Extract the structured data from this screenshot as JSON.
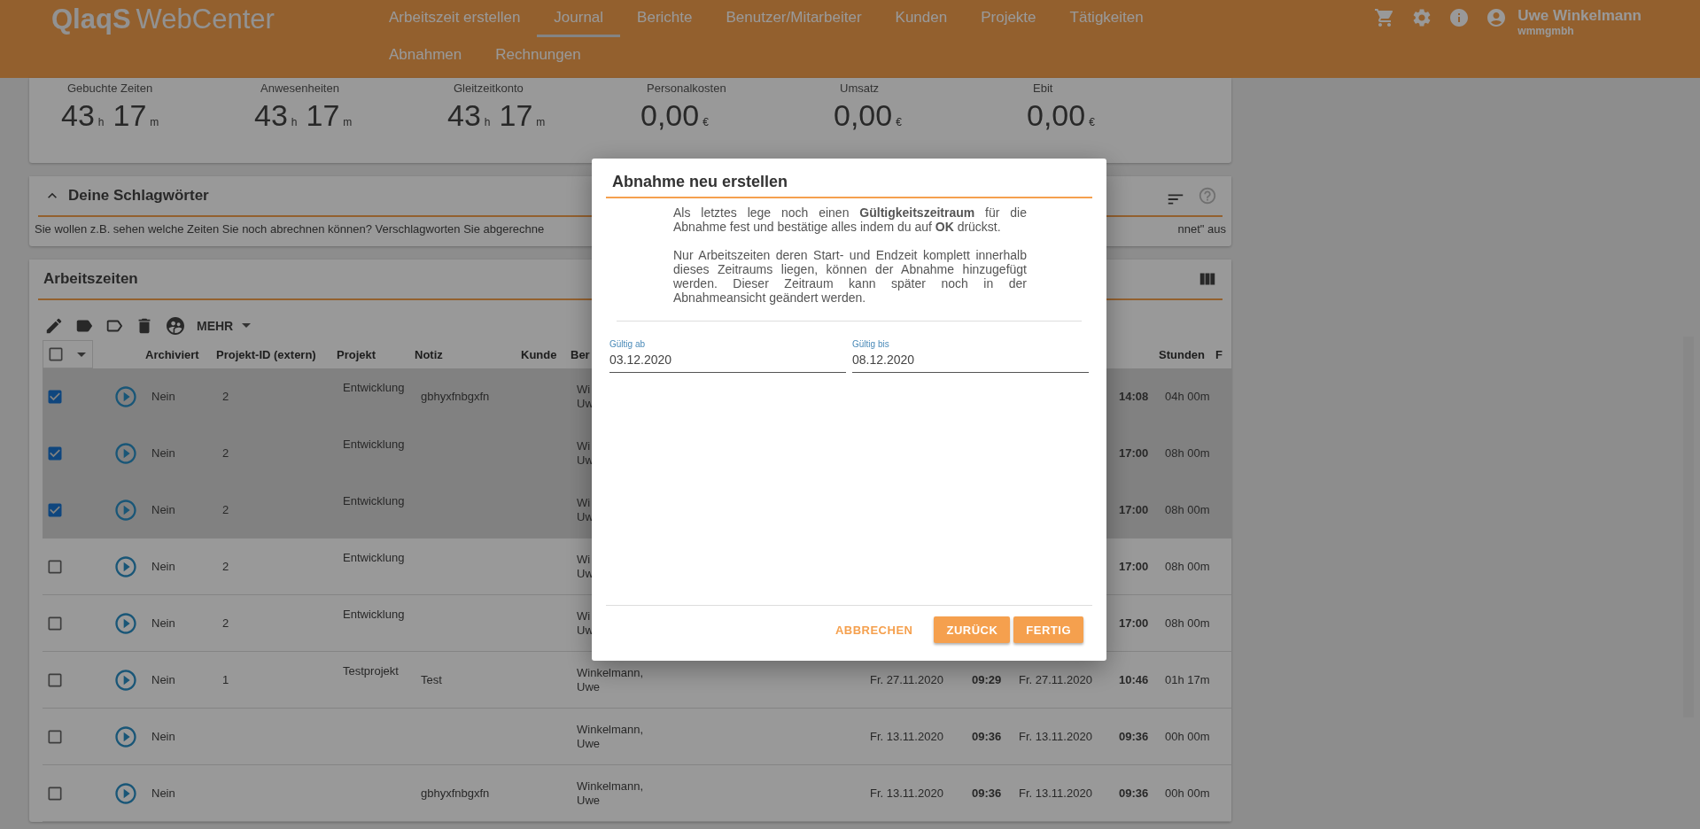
{
  "header": {
    "logo_bold": "QlaqS",
    "logo_light": "WebCenter",
    "nav": [
      {
        "label": "Arbeitszeit erstellen",
        "selected": false
      },
      {
        "label": "Journal",
        "selected": true
      },
      {
        "label": "Berichte",
        "selected": false
      },
      {
        "label": "Benutzer/Mitarbeiter",
        "selected": false
      },
      {
        "label": "Kunden",
        "selected": false
      },
      {
        "label": "Projekte",
        "selected": false
      },
      {
        "label": "Tätigkeiten",
        "selected": false
      },
      {
        "label": "Abnahmen",
        "selected": false
      },
      {
        "label": "Rechnungen",
        "selected": false
      }
    ],
    "user": {
      "name": "Uwe Winkelmann",
      "company": "wmmgmbh"
    }
  },
  "stats": [
    {
      "label": "Gebuchte Zeiten",
      "parts": [
        {
          "number": "43",
          "unit": "h"
        },
        {
          "number": "17",
          "unit": "m"
        }
      ]
    },
    {
      "label": "Anwesenheiten",
      "parts": [
        {
          "number": "43",
          "unit": "h"
        },
        {
          "number": "17",
          "unit": "m"
        }
      ]
    },
    {
      "label": "Gleitzeitkonto",
      "parts": [
        {
          "number": "43",
          "unit": "h"
        },
        {
          "number": "17",
          "unit": "m"
        }
      ]
    },
    {
      "label": "Personalkosten",
      "parts": [
        {
          "number": "0,00",
          "unit": "€"
        }
      ]
    },
    {
      "label": "Umsatz",
      "parts": [
        {
          "number": "0,00",
          "unit": "€"
        }
      ]
    },
    {
      "label": "Ebit",
      "parts": [
        {
          "number": "0,00",
          "unit": "€"
        }
      ]
    }
  ],
  "keywords_panel": {
    "title": "Deine Schlagwörter",
    "expanded": true,
    "text_left": "Sie wollen z.B. sehen welche Zeiten Sie noch abrechnen können? Verschlagworten Sie abgerechne",
    "text_right": "nnet\" aus"
  },
  "worktimes": {
    "title": "Arbeitszeiten",
    "more": "MEHR",
    "select_all": false,
    "columns": [
      "Archiviert",
      "Projekt-ID (extern)",
      "Projekt",
      "Notiz",
      "Kunde",
      "Ber",
      "Stunden",
      "F"
    ],
    "rows": [
      {
        "selected": true,
        "archived": "Nein",
        "project_id": "2",
        "project": "Entwicklung",
        "note": "gbhyxfnbgxfn",
        "editor": "Wi\nUw",
        "end_time": "14:08",
        "hours": "04h 00m"
      },
      {
        "selected": true,
        "archived": "Nein",
        "project_id": "2",
        "project": "Entwicklung",
        "editor": "Wi\nUw",
        "end_time": "17:00",
        "hours": "08h 00m"
      },
      {
        "selected": true,
        "archived": "Nein",
        "project_id": "2",
        "project": "Entwicklung",
        "editor": "Wi\nUw",
        "end_time": "17:00",
        "hours": "08h 00m"
      },
      {
        "selected": false,
        "archived": "Nein",
        "project_id": "2",
        "project": "Entwicklung",
        "editor": "Wi\nUw",
        "end_time": "17:00",
        "hours": "08h 00m"
      },
      {
        "selected": false,
        "archived": "Nein",
        "project_id": "2",
        "project": "Entwicklung",
        "editor": "Wi\nUw",
        "end_time": "17:00",
        "hours": "08h 00m"
      },
      {
        "selected": false,
        "archived": "Nein",
        "project_id": "1",
        "project": "Testprojekt",
        "note": "Test",
        "editor": "Winkelmann,\nUwe",
        "start_date": "Fr. 27.11.2020",
        "start_time": "09:29",
        "end_date": "Fr. 27.11.2020",
        "end_time": "10:46",
        "hours": "01h 17m"
      },
      {
        "selected": false,
        "archived": "Nein",
        "editor": "Winkelmann,\nUwe",
        "start_date": "Fr. 13.11.2020",
        "start_time": "09:36",
        "end_date": "Fr. 13.11.2020",
        "end_time": "09:36",
        "hours": "00h 00m"
      },
      {
        "selected": false,
        "archived": "Nein",
        "note": "gbhyxfnbgxfn",
        "editor": "Winkelmann,\nUwe",
        "start_date": "Fr. 13.11.2020",
        "start_time": "09:36",
        "end_date": "Fr. 13.11.2020",
        "end_time": "09:36",
        "hours": "00h 00m"
      }
    ]
  },
  "dialog": {
    "title": "Abnahme neu erstellen",
    "paragraphs": [
      "Als letztes lege noch einen **Gültigkeitszeitraum** für die Abnahme fest und bestätige alles indem du auf **OK** drückst.",
      "Nur Arbeitszeiten deren Start- und Endzeit komplett innerhalb dieses Zeitraums liegen, können der Abnahme hinzugefügt werden. Dieser Zeitraum kann später noch in der Abnahmeansicht geändert werden."
    ],
    "fields": [
      {
        "label": "Gültig ab",
        "value": "03.12.2020"
      },
      {
        "label": "Gültig bis",
        "value": "08.12.2020"
      }
    ],
    "buttons": [
      {
        "label": "ABBRECHEN",
        "kind": "text"
      },
      {
        "label": "ZURÜCK",
        "kind": "raised"
      },
      {
        "label": "FERTIG",
        "kind": "raised"
      }
    ]
  }
}
